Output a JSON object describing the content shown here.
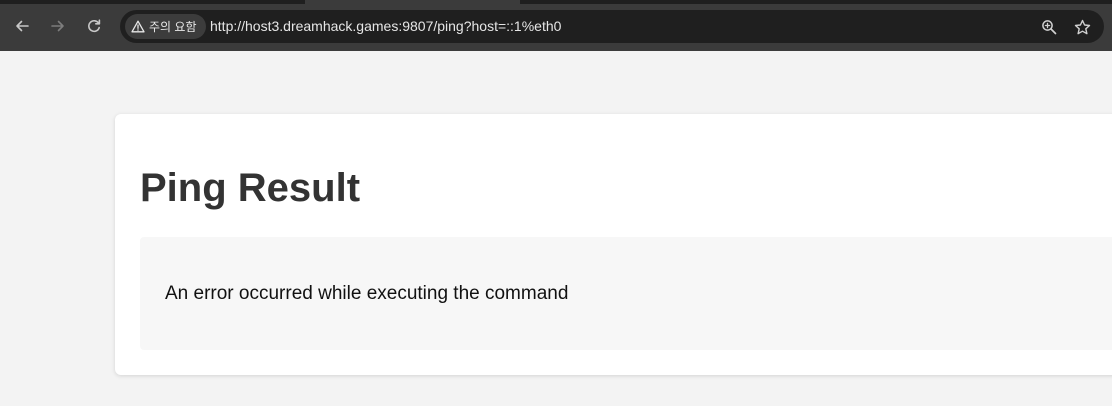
{
  "browser": {
    "security_chip_label": "주의 요함",
    "url": "http://host3.dreamhack.games:9807/ping?host=::1%eth0",
    "back_icon": "arrow-left-icon",
    "forward_icon": "arrow-right-icon",
    "reload_icon": "reload-icon",
    "warning_icon": "warning-triangle-icon",
    "zoom_icon": "zoom-in-icon",
    "bookmark_icon": "star-icon"
  },
  "page": {
    "title": "Ping Result",
    "result_message": "An error occurred while executing the command"
  },
  "colors": {
    "toolbar": "#3b3b3b",
    "omnibox": "#1f1f1f",
    "page_background": "#f3f3f3",
    "card": "#ffffff",
    "result_box": "#f7f7f7",
    "title_text": "#333333"
  }
}
